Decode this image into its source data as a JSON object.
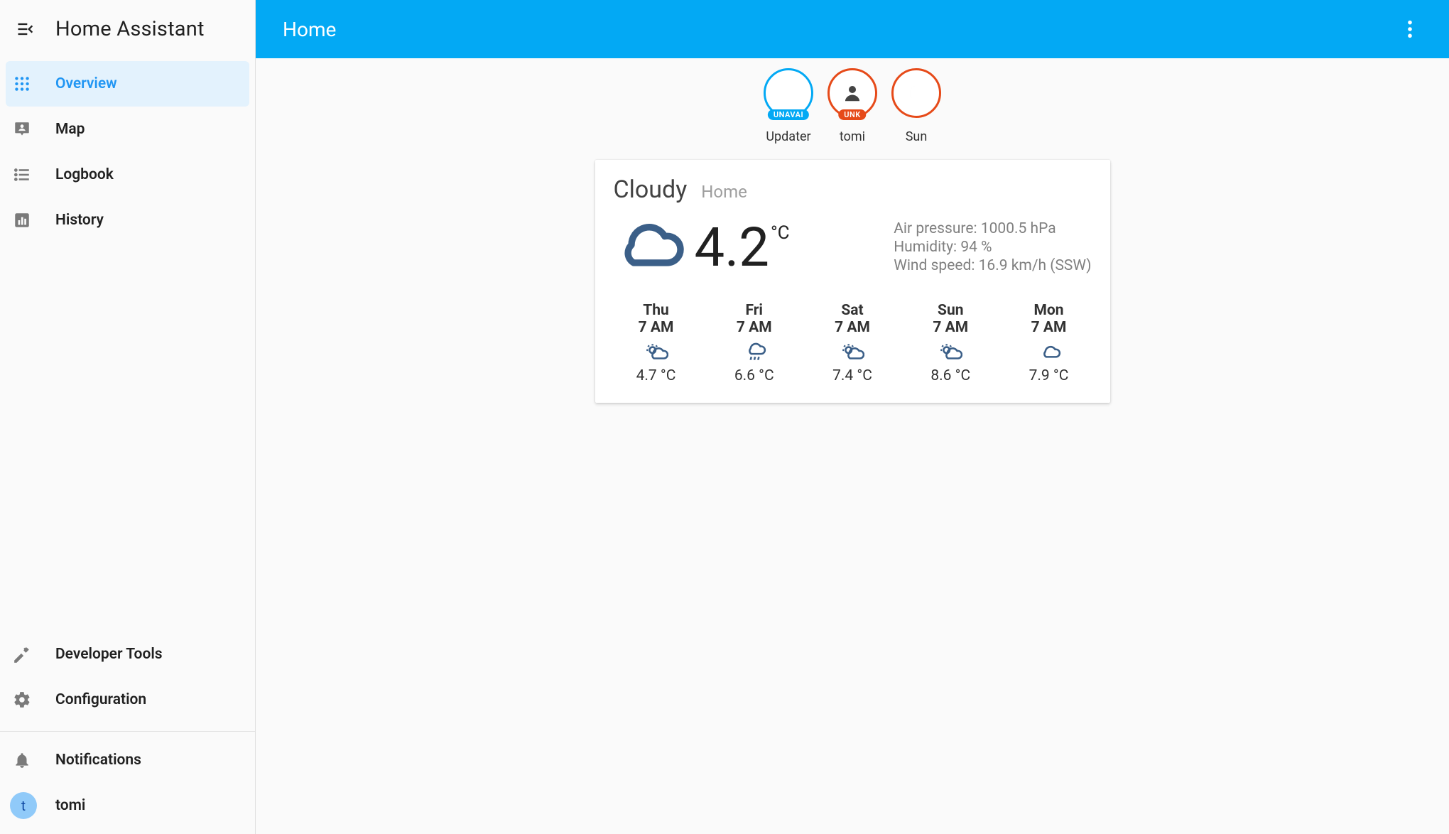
{
  "app_title": "Home Assistant",
  "sidebar": {
    "items": [
      {
        "label": "Overview",
        "active": true
      },
      {
        "label": "Map"
      },
      {
        "label": "Logbook"
      },
      {
        "label": "History"
      }
    ],
    "bottom_items": [
      {
        "label": "Developer Tools"
      },
      {
        "label": "Configuration"
      }
    ],
    "notifications_label": "Notifications",
    "user": {
      "initial": "t",
      "name": "tomi"
    }
  },
  "header": {
    "title": "Home"
  },
  "badges": [
    {
      "name": "Updater",
      "state_chip": "UNAVAI",
      "border": "#03a9f4",
      "chip_bg": "#03a9f4",
      "icon": "blank"
    },
    {
      "name": "tomi",
      "state_chip": "UNK",
      "border": "#e64a19",
      "chip_bg": "#e64a19",
      "icon": "person"
    },
    {
      "name": "Sun",
      "state_chip": "",
      "border": "#e64a19",
      "chip_bg": "",
      "icon": "crescent"
    }
  ],
  "weather": {
    "state": "Cloudy",
    "name": "Home",
    "temperature": "4.2",
    "temperature_unit": "°C",
    "attributes": {
      "air_pressure_label": "Air pressure",
      "air_pressure_value": "1000.5 hPa",
      "humidity_label": "Humidity",
      "humidity_value": "94 %",
      "wind_label": "Wind speed",
      "wind_value": "16.9 km/h (SSW)"
    },
    "forecast": [
      {
        "day": "Thu",
        "time": "7 AM",
        "temp": "4.7 °C",
        "cond": "partlycloudy"
      },
      {
        "day": "Fri",
        "time": "7 AM",
        "temp": "6.6 °C",
        "cond": "rainy"
      },
      {
        "day": "Sat",
        "time": "7 AM",
        "temp": "7.4 °C",
        "cond": "partlycloudy"
      },
      {
        "day": "Sun",
        "time": "7 AM",
        "temp": "8.6 °C",
        "cond": "partlycloudy"
      },
      {
        "day": "Mon",
        "time": "7 AM",
        "temp": "7.9 °C",
        "cond": "cloudy"
      }
    ]
  }
}
